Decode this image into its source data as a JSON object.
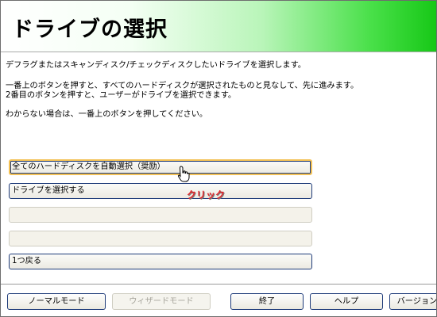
{
  "header": {
    "title": "ドライブの選択"
  },
  "body": {
    "line1": "デフラグまたはスキャンディスク/チェックディスクしたいドライブを選択します。",
    "line2": "一番上のボタンを押すと、すべてのハードディスクが選択されたものと見なして、先に進みます。",
    "line3": "2番目のボタンを押すと、ユーザーがドライブを選択できます。",
    "line4": "わからない場合は、一番上のボタンを押してください。"
  },
  "options": {
    "auto_select_all": "全てのハードディスクを自動選択（奨励）",
    "select_drive": "ドライブを選択する",
    "empty1": "",
    "empty2": "",
    "back": "1つ戻る"
  },
  "annotation": {
    "click": "クリック"
  },
  "footer": {
    "normal_mode": "ノーマルモード",
    "wizard_mode": "ウィザードモード",
    "exit": "終了",
    "help": "ヘルプ",
    "version": "バージョン"
  },
  "colors": {
    "header_gradient_end": "#17c817",
    "button_border": "#1f3c7a",
    "hover_border": "#f3c155",
    "annotation": "#e5262b"
  }
}
